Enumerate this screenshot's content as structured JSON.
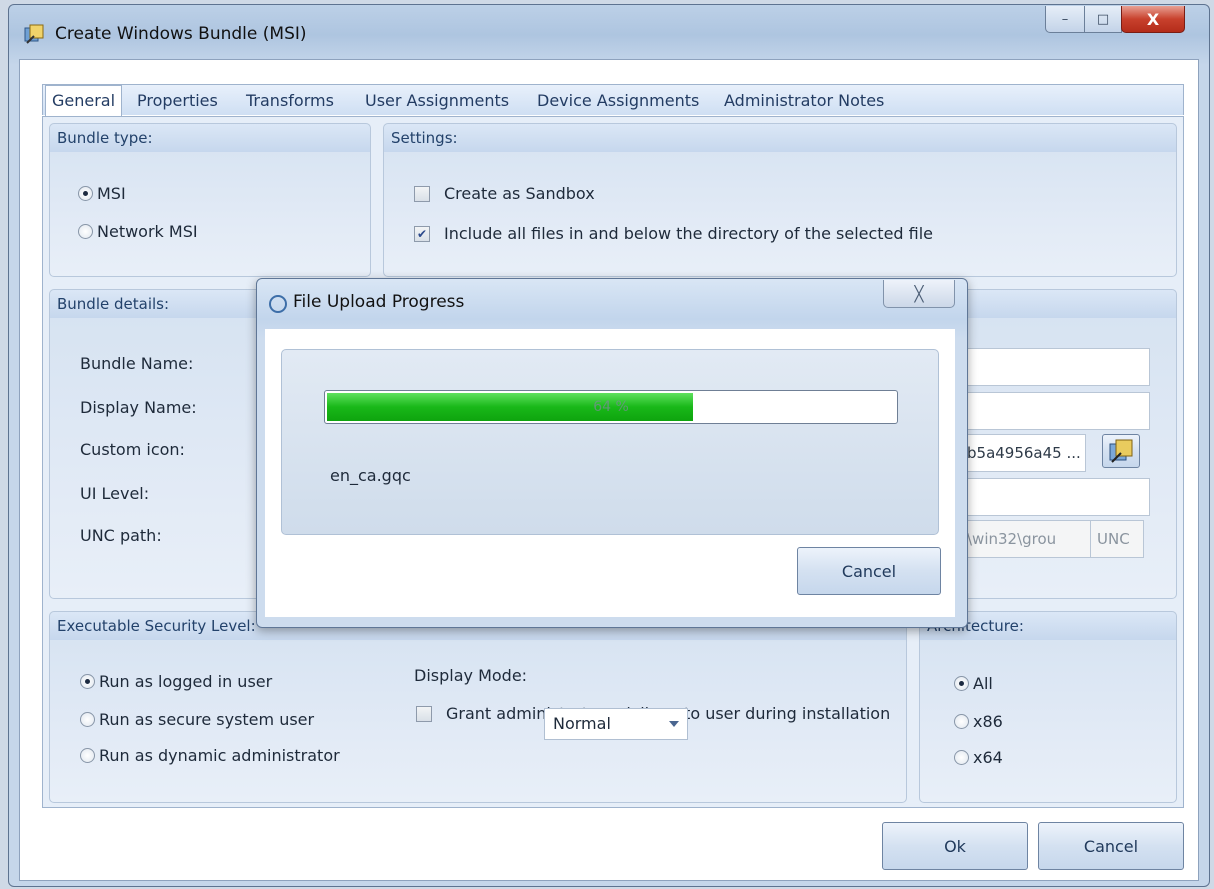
{
  "window": {
    "title": "Create Windows Bundle (MSI)",
    "minimize_glyph": "–",
    "maximize_glyph": "□",
    "close_glyph": "X"
  },
  "tabs": [
    {
      "label": "General",
      "active": true
    },
    {
      "label": "Properties"
    },
    {
      "label": "Transforms"
    },
    {
      "label": "User Assignments"
    },
    {
      "label": "Device Assignments"
    },
    {
      "label": "Administrator Notes"
    }
  ],
  "bundle_type": {
    "title": "Bundle type:",
    "options": [
      {
        "label": "MSI",
        "selected": true
      },
      {
        "label": "Network MSI",
        "selected": false
      }
    ]
  },
  "settings": {
    "title": "Settings:",
    "create_sandbox": {
      "label": "Create as Sandbox",
      "checked": false
    },
    "include_files": {
      "label": "Include all files in and below the directory of the selected file",
      "checked": true
    }
  },
  "bundle_details": {
    "title": "Bundle details:",
    "labels": [
      "Bundle Name:",
      "Display Name:",
      "Custom icon:",
      "UI Level:",
      "UNC path:"
    ],
    "custom_icon_value": "b5a4956a45 ...",
    "unc_value": "\\win32\\grou",
    "unc_button": "UNC"
  },
  "security": {
    "title": "Executable Security Level:",
    "options": [
      {
        "label": "Run as logged in user",
        "selected": true
      },
      {
        "label": "Run as secure system user",
        "selected": false
      },
      {
        "label": "Run as dynamic administrator",
        "selected": false
      }
    ],
    "display_mode_label": "Display Mode:",
    "display_mode_value": "Normal",
    "grant_admin": {
      "label": "Grant administrator privilege to user during installation",
      "checked": false
    }
  },
  "architecture": {
    "title": "Architecture:",
    "visible_title": "rchitecture:",
    "options": [
      {
        "label": "All",
        "selected": true
      },
      {
        "label": "x86",
        "selected": false
      },
      {
        "label": "x64",
        "selected": false
      }
    ]
  },
  "footer": {
    "ok": "Ok",
    "cancel": "Cancel"
  },
  "dialog": {
    "title": "File Upload Progress",
    "close_glyph": "╳",
    "progress_percent": 64,
    "progress_text": "64 %",
    "file_name": "en_ca.gqc",
    "cancel": "Cancel"
  },
  "colors": {
    "progress": "#19b819",
    "accent": "#233c63"
  }
}
